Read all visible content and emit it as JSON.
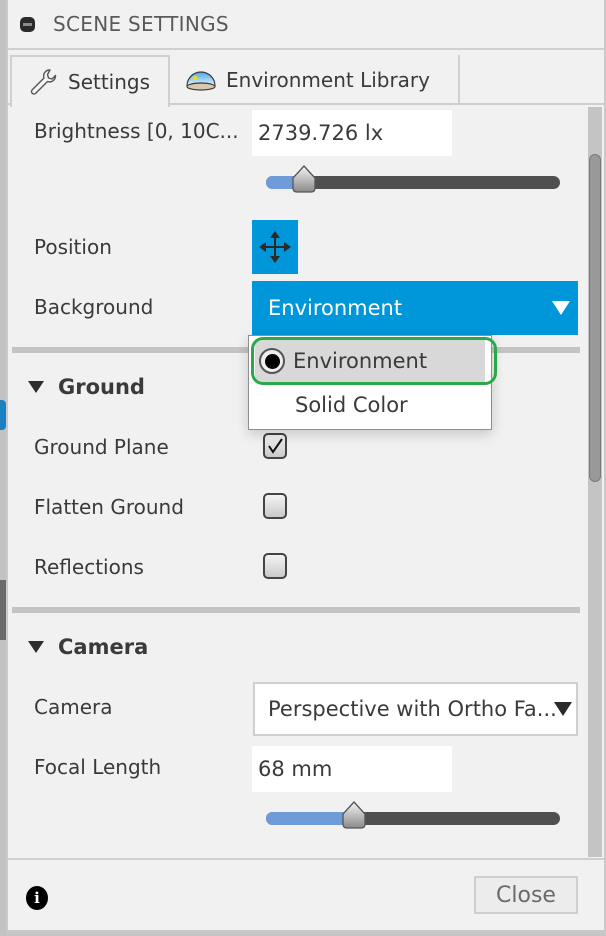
{
  "window": {
    "title": "SCENE SETTINGS",
    "title_icon": "collapse-icon"
  },
  "tabs": [
    {
      "label": "Settings",
      "icon": "wrench-icon",
      "active": true
    },
    {
      "label": "Environment Library",
      "icon": "environment-dome-icon",
      "active": false
    }
  ],
  "settings": {
    "brightness": {
      "label": "Brightness [0, 10C...",
      "value": "2739.726 lx",
      "slider_fraction": 0.13
    },
    "position": {
      "label": "Position",
      "icon": "move-arrows-icon"
    },
    "background": {
      "label": "Background",
      "selected": "Environment",
      "options": [
        {
          "label": "Environment",
          "selected": true
        },
        {
          "label": "Solid Color",
          "selected": false
        }
      ]
    }
  },
  "ground": {
    "header": "Ground",
    "items": [
      {
        "label": "Ground Plane",
        "checked": true
      },
      {
        "label": "Flatten Ground",
        "checked": false
      },
      {
        "label": "Reflections",
        "checked": false
      }
    ]
  },
  "camera": {
    "header": "Camera",
    "camera_label": "Camera",
    "camera_value": "Perspective with Ortho Fa...",
    "focal_label": "Focal Length",
    "focal_value": "68 mm",
    "focal_slider_fraction": 0.3
  },
  "footer": {
    "info_icon": "info-icon",
    "close_label": "Close"
  },
  "colors": {
    "accent": "#0096da",
    "slider_fill": "#6f9bd9",
    "highlight": "#2aa84a"
  }
}
